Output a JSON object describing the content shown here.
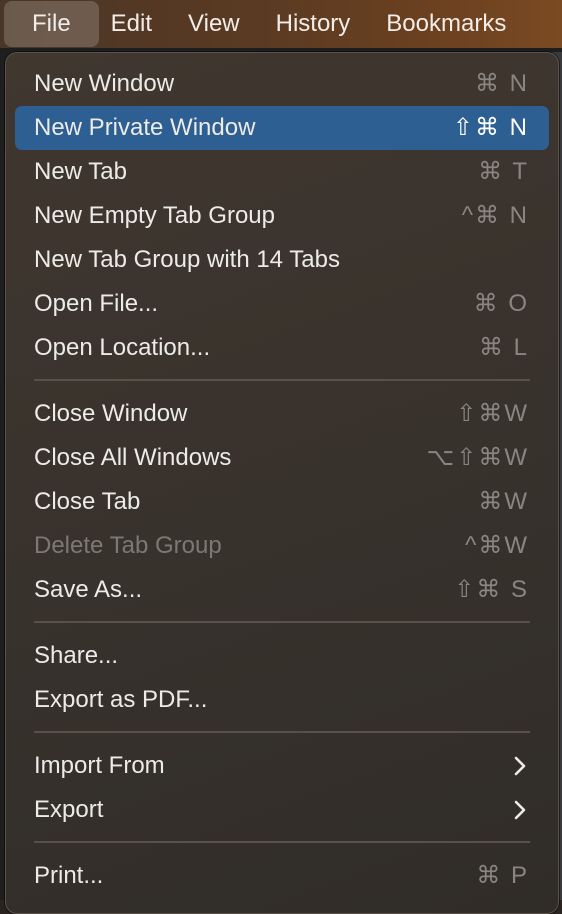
{
  "menubar": {
    "items": [
      "File",
      "Edit",
      "View",
      "History",
      "Bookmarks"
    ],
    "active": "File"
  },
  "menu": {
    "items": [
      {
        "label": "New Window",
        "shortcut": "⌘ N"
      },
      {
        "label": "New Private Window",
        "shortcut": "⇧⌘ N",
        "highlighted": true
      },
      {
        "label": "New Tab",
        "shortcut": "⌘ T"
      },
      {
        "label": "New Empty Tab Group",
        "shortcut": "^⌘ N"
      },
      {
        "label": "New Tab Group with 14 Tabs",
        "shortcut": ""
      },
      {
        "label": "Open File...",
        "shortcut": "⌘ O"
      },
      {
        "label": "Open Location...",
        "shortcut": "⌘ L"
      },
      {
        "label": "Close Window",
        "shortcut": "⇧⌘W"
      },
      {
        "label": "Close All Windows",
        "shortcut": "⌥⇧⌘W"
      },
      {
        "label": "Close Tab",
        "shortcut": "⌘W"
      },
      {
        "label": "Delete Tab Group",
        "shortcut": "^⌘W",
        "disabled": true
      },
      {
        "label": "Save As...",
        "shortcut": "⇧⌘ S"
      },
      {
        "label": "Share...",
        "shortcut": ""
      },
      {
        "label": "Export as PDF...",
        "shortcut": ""
      },
      {
        "label": "Import From",
        "submenu": true
      },
      {
        "label": "Export",
        "submenu": true
      },
      {
        "label": "Print...",
        "shortcut": "⌘ P"
      }
    ],
    "icons": {
      "submenu": "chevron-right-icon"
    }
  },
  "colors": {
    "highlight": "#2d5f92",
    "menu_background": "#3a332d",
    "text": "#ecebe8",
    "shortcut_text": "#8a8580",
    "disabled_text": "#7d7873"
  }
}
